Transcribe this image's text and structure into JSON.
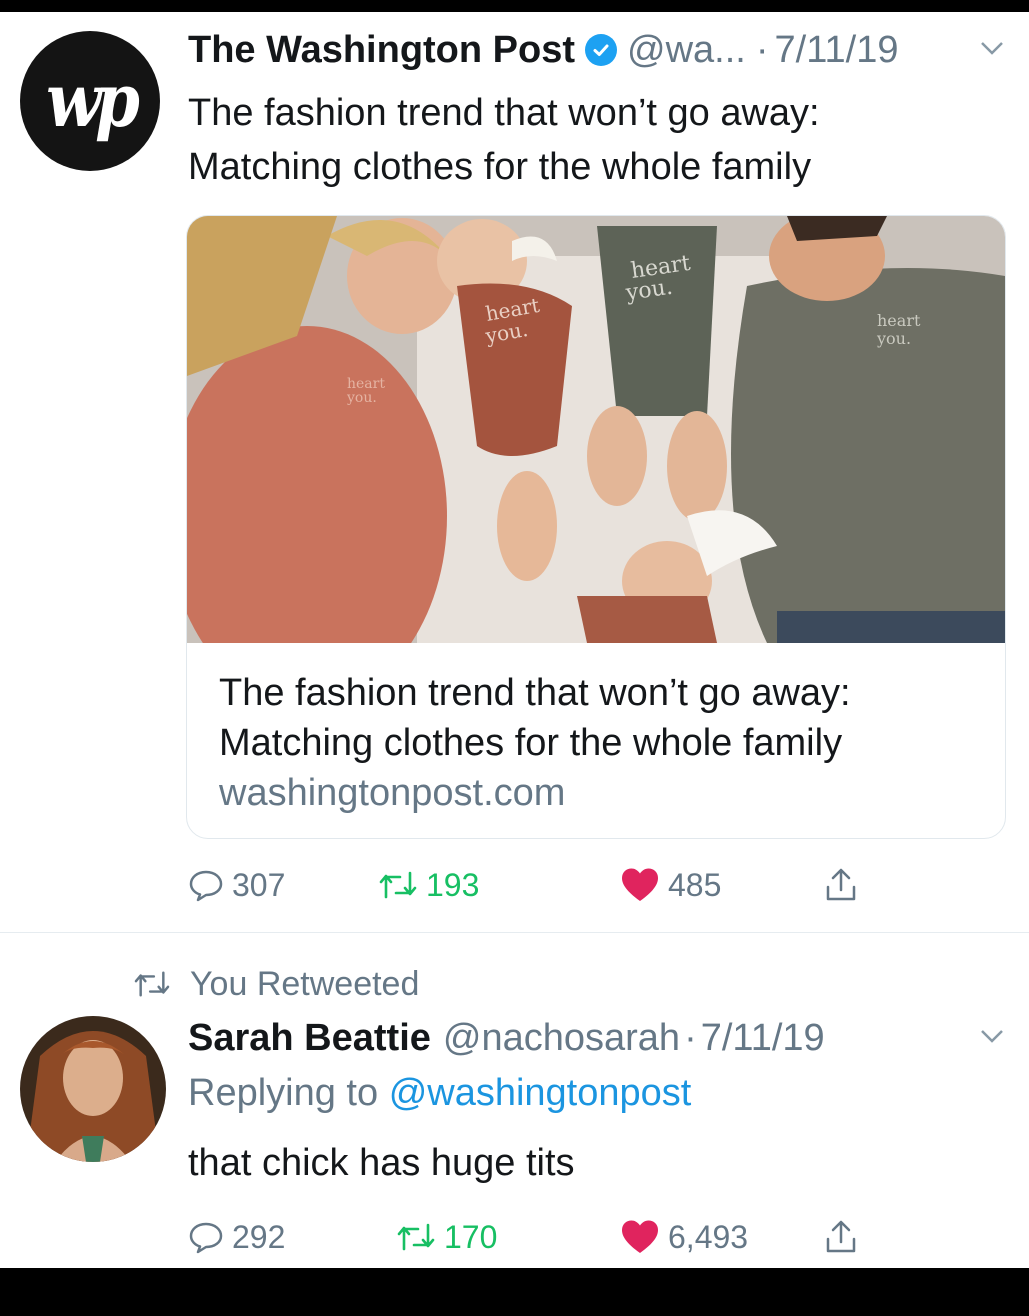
{
  "tweet1": {
    "author_name": "The Washington Post",
    "handle": "@wa...",
    "separator": "·",
    "date": "7/11/19",
    "avatar_text": "wp",
    "text_line1": "The fashion trend that won’t go away:",
    "text_line2": "Matching clothes for the whole family",
    "card": {
      "title_line1": "The fashion trend that won’t go away:",
      "title_line2": "Matching clothes for the whole family",
      "domain": "washingtonpost.com",
      "shirt_text": [
        "heart",
        "you."
      ]
    },
    "actions": {
      "replies": "307",
      "retweets": "193",
      "likes": "485"
    }
  },
  "tweet2": {
    "social_context": "You Retweeted",
    "author_name": "Sarah Beattie",
    "handle": "@nachosarah",
    "separator": "·",
    "date": "7/11/19",
    "replying_prefix": "Replying to",
    "replying_handle": "@washingtonpost",
    "text": "that chick has huge tits",
    "actions": {
      "replies": "292",
      "retweets": "170",
      "likes": "6,493"
    }
  },
  "colors": {
    "text": "#14171a",
    "secondary": "#657786",
    "verified": "#1da1f2",
    "link": "#1b95e0",
    "retweet_green": "#17bf63",
    "like_red": "#e0245e"
  },
  "icons": [
    "verified-badge-icon",
    "chevron-down-icon",
    "reply-icon",
    "retweet-icon",
    "heart-icon",
    "share-icon"
  ]
}
